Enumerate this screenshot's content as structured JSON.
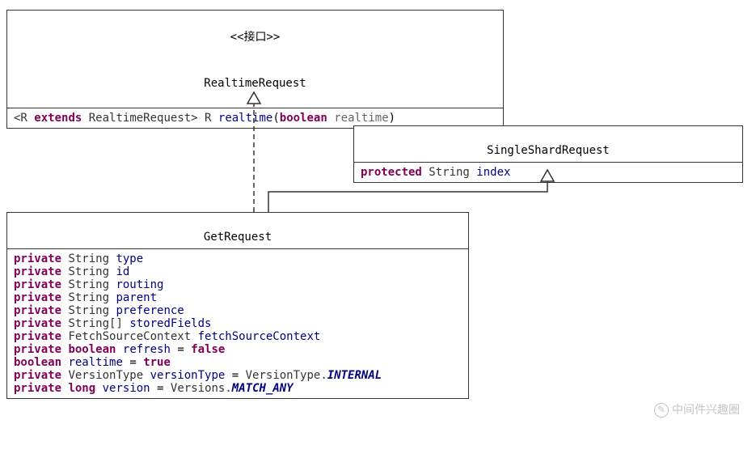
{
  "interface": {
    "stereotype": "<<接口>>",
    "name": "RealtimeRequest",
    "method_prefix": "<R ",
    "kw_extends": "extends",
    "method_generic": " RealtimeRequest> R ",
    "method_name": "realtime",
    "kw_boolean": "boolean",
    "param_name": "realtime",
    "lparen": "(",
    "rparen": ")"
  },
  "shard": {
    "name": "SingleShardRequest",
    "kw_protected": "protected",
    "field_type": " String ",
    "field_name": "index"
  },
  "get": {
    "name": "GetRequest",
    "fields": [
      {
        "mod": "private",
        "type": " String ",
        "name": "type",
        "suffix": ""
      },
      {
        "mod": "private",
        "type": " String ",
        "name": "id",
        "suffix": ""
      },
      {
        "mod": "private",
        "type": " String ",
        "name": "routing",
        "suffix": ""
      },
      {
        "mod": "private",
        "type": " String ",
        "name": "parent",
        "suffix": ""
      },
      {
        "mod": "private",
        "type": " String ",
        "name": "preference",
        "suffix": ""
      },
      {
        "mod": "private",
        "type": " String[] ",
        "name": "storedFields",
        "suffix": ""
      },
      {
        "mod": "private",
        "type": " FetchSourceContext ",
        "name": "fetchSourceContext",
        "suffix": ""
      },
      {
        "mod": "private",
        "type": " ",
        "kw2": "boolean",
        "name": "refresh",
        "eq": " = ",
        "val": "false",
        "valkw": true
      },
      {
        "mod": "",
        "type": "",
        "kw2": "boolean",
        "name": "realtime",
        "eq": " = ",
        "val": "true",
        "valkw": true
      },
      {
        "mod": "private",
        "type": " VersionType ",
        "name": "versionType",
        "eq": " = ",
        "rhs_type": "VersionType.",
        "rhs_const": "INTERNAL"
      },
      {
        "mod": "private",
        "type": " ",
        "kw2": "long",
        "name": "version",
        "eq": " = ",
        "rhs_type": "Versions.",
        "rhs_const": "MATCH_ANY"
      }
    ]
  },
  "watermark": "中间件兴趣圈"
}
